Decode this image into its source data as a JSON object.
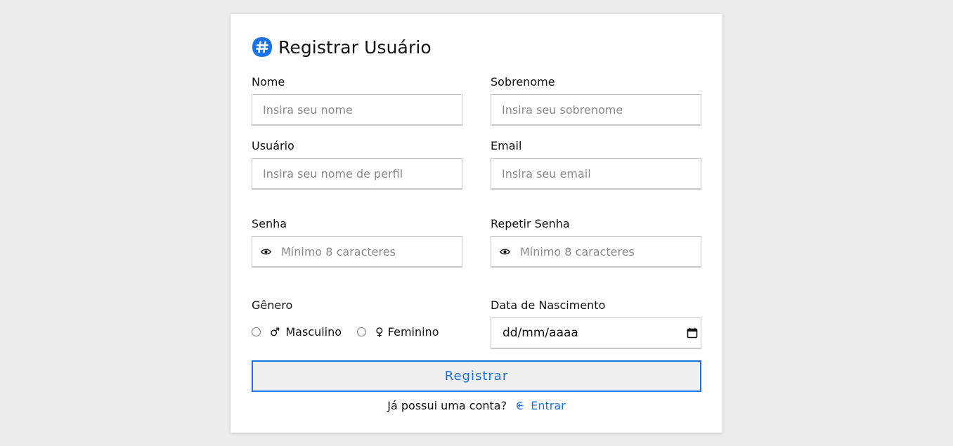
{
  "form": {
    "title": "Registrar Usuário",
    "logo_icon": "hashtag-icon",
    "fields": {
      "nome": {
        "label": "Nome",
        "placeholder": "Insira seu nome"
      },
      "sobrenome": {
        "label": "Sobrenome",
        "placeholder": "Insira seu sobrenome"
      },
      "usuario": {
        "label": "Usuário",
        "placeholder": "Insira seu nome de perfil"
      },
      "email": {
        "label": "Email",
        "placeholder": "Insira seu email"
      },
      "senha": {
        "label": "Senha",
        "placeholder": "Mínimo 8 caracteres",
        "icon": "eye-icon"
      },
      "repetir_senha": {
        "label": "Repetir Senha",
        "placeholder": "Mínimo 8 caracteres",
        "icon": "eye-icon"
      }
    },
    "genero": {
      "label": "Gênero",
      "options": [
        {
          "symbol": "♂",
          "label": "Masculino"
        },
        {
          "symbol": "♀",
          "label": "Feminino"
        }
      ]
    },
    "nascimento": {
      "label": "Data de Nascimento",
      "value": "dd/mm/aaaa",
      "icon": "calendar-icon"
    },
    "submit_label": "Registrar",
    "footer": {
      "text": "Já possui uma conta?",
      "link_icon": "login-arrow-icon",
      "link_label": "Entrar"
    }
  },
  "colors": {
    "accent": "#1a73e8",
    "background": "#ececec",
    "card": "#ffffff"
  }
}
